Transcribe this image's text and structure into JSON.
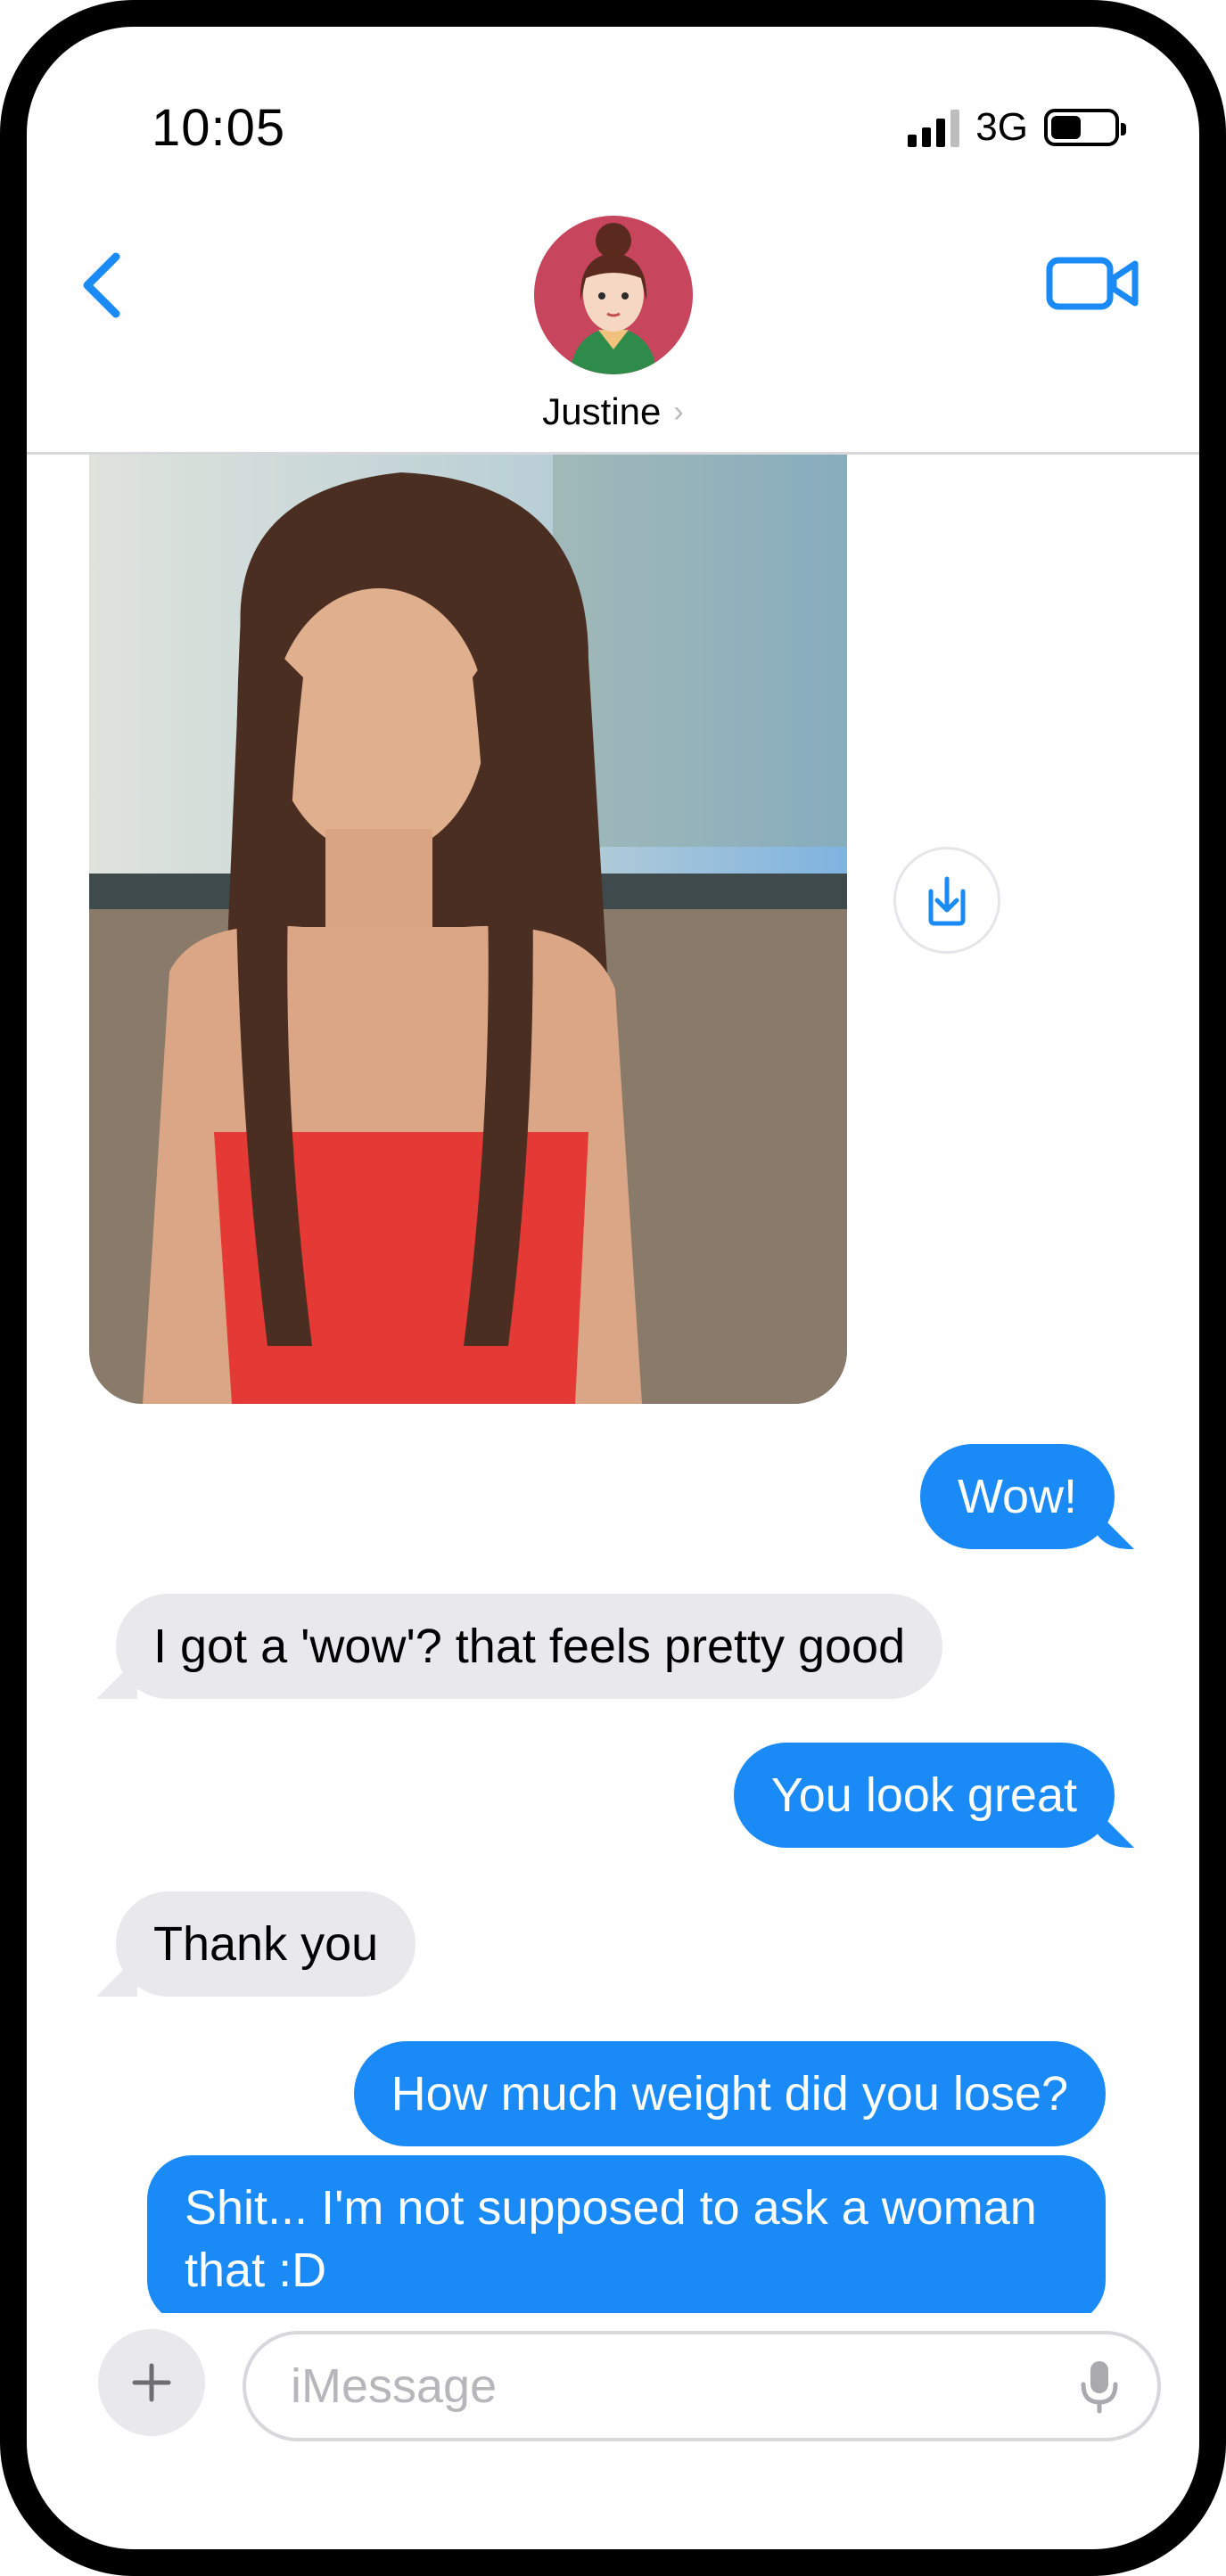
{
  "status_bar": {
    "time": "10:05",
    "network": "3G"
  },
  "header": {
    "contact_name": "Justine"
  },
  "messages": [
    {
      "direction": "sent",
      "text": "Wow!"
    },
    {
      "direction": "received",
      "text": "I got a 'wow'?  that feels pretty good"
    },
    {
      "direction": "sent",
      "text": "You look great"
    },
    {
      "direction": "received",
      "text": "Thank you"
    },
    {
      "direction": "sent",
      "text": "How much weight did you lose?"
    },
    {
      "direction": "sent",
      "text": "Shit... I'm not supposed to ask a woman that :D"
    }
  ],
  "input": {
    "placeholder": "iMessage"
  },
  "icons": {
    "back": "chevron-left-icon",
    "video": "video-camera-icon",
    "save": "download-icon",
    "plus": "plus-icon",
    "mic": "microphone-icon"
  },
  "colors": {
    "accent": "#1a8af7",
    "received_bubble": "#e9e9eb",
    "text": "#000000"
  }
}
